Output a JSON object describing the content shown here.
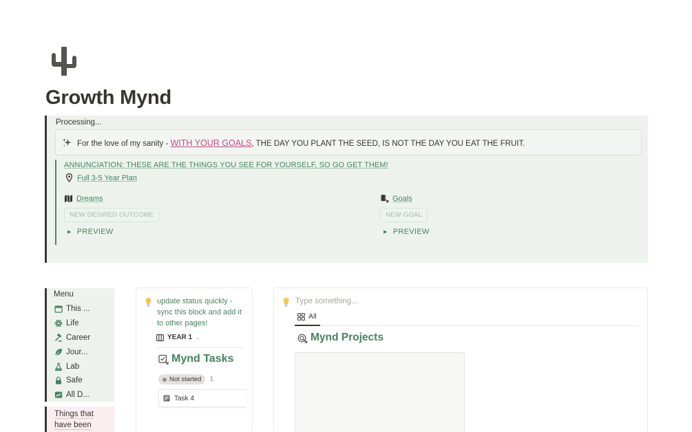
{
  "page": {
    "title": "Growth Mynd",
    "icon": "cactus-icon"
  },
  "callout": {
    "processing": "Processing...",
    "quote_prefix": "For the love of my sanity - ",
    "quote_link": "WITH YOUR GOALS",
    "quote_suffix": ", THE DAY YOU PLANT THE SEED, IS NOT THE DAY YOU EAT THE FRUIT.",
    "annunciation": "ANNUNCIATION: THESE ARE THE THINGS YOU SEE FOR YOURSELF, SO GO GET THEM!",
    "plan_link": "Full 3-5 Year Plan",
    "left_column": {
      "title": "Dreams",
      "icon": "map-icon",
      "new_button": "NEW DESIRED OUTCOME",
      "toggle": "PREVIEW"
    },
    "right_column": {
      "title": "Goals",
      "icon": "coins-icon",
      "new_button": "NEW GOAL",
      "toggle": "PREVIEW"
    }
  },
  "menu": {
    "title": "Menu",
    "items": [
      {
        "label": "This ...",
        "icon": "calendar-icon"
      },
      {
        "label": "Life",
        "icon": "atom-icon"
      },
      {
        "label": "Career",
        "icon": "gavel-icon"
      },
      {
        "label": "Jour...",
        "icon": "leaf-icon"
      },
      {
        "label": "Lab",
        "icon": "flask-icon"
      },
      {
        "label": "Safe",
        "icon": "lock-icon"
      },
      {
        "label": "All D...",
        "icon": "chart-icon"
      }
    ],
    "things_line1": "Things that",
    "things_line2": "have been"
  },
  "tasks_card": {
    "hint": "update status quickly - sync this block and add it to other pages!",
    "view_label": "YEAR 1",
    "db_title": "Mynd Tasks",
    "status_label": "Not started",
    "status_count": "1",
    "task_label": "Task 4"
  },
  "projects_card": {
    "placeholder": "Type something...",
    "tab_label": "All",
    "db_title": "Mynd Projects"
  },
  "colors": {
    "callout_bg": "#edf3ec",
    "green_text": "#448361",
    "pink_link": "#c14c8a",
    "menu_bg": "#edf3ec",
    "things_bg": "#faeef1"
  }
}
